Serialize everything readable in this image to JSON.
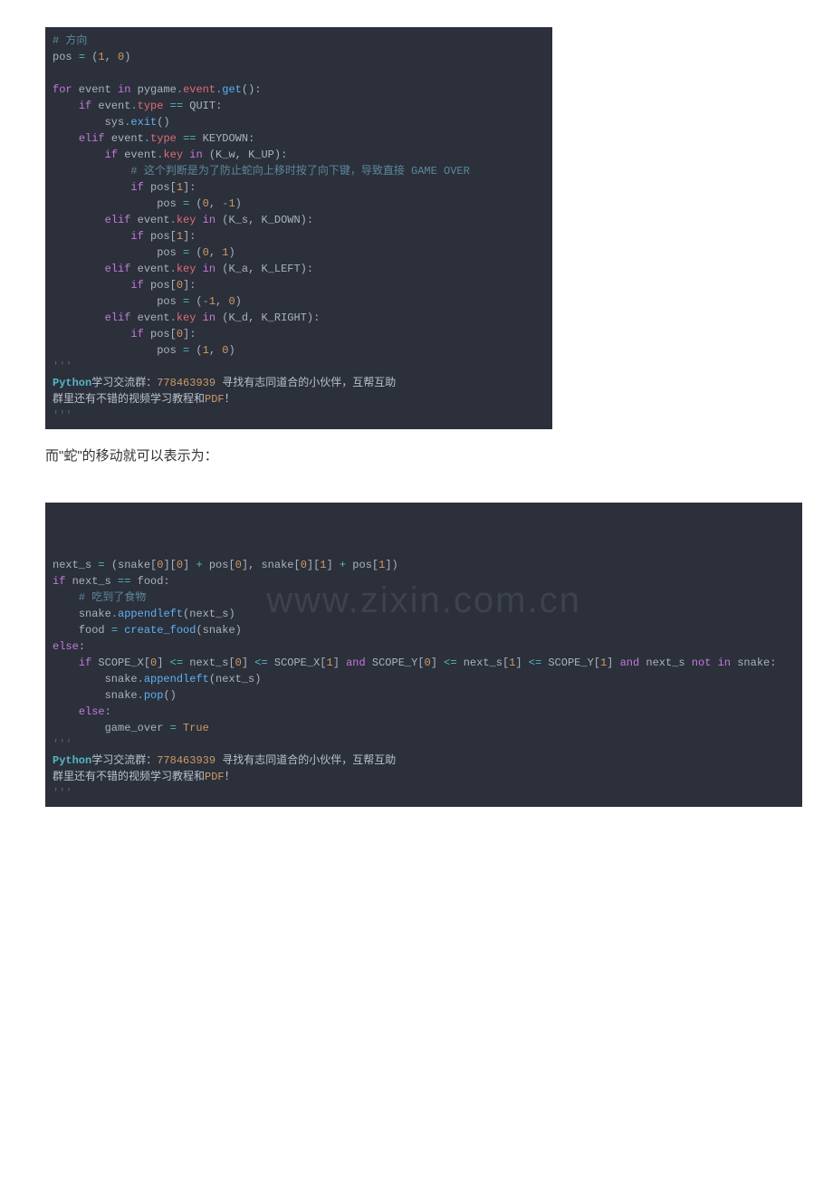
{
  "block1": {
    "lines": [
      {
        "html": "<span class='c-cmt'># 方向</span>"
      },
      {
        "html": "<span class='c-pl'>pos </span><span class='c-op'>=</span><span class='c-pl'> (</span><span class='c-num'>1</span><span class='c-pl'>, </span><span class='c-num'>0</span><span class='c-pl'>)</span>"
      },
      {
        "html": ""
      },
      {
        "html": "<span class='c-key'>for</span><span class='c-pl'> event </span><span class='c-key'>in</span><span class='c-pl'> pygame</span><span class='c-op'>.</span><span class='c-id'>event</span><span class='c-op'>.</span><span class='c-call2'>get</span><span class='c-pl'>():</span>"
      },
      {
        "html": "    <span class='c-key'>if</span><span class='c-pl'> event</span><span class='c-op'>.</span><span class='c-id'>type</span><span class='c-pl'> </span><span class='c-op'>==</span><span class='c-pl'> QUIT:</span>"
      },
      {
        "html": "        <span class='c-pl'>sys</span><span class='c-op'>.</span><span class='c-call2'>exit</span><span class='c-pl'>()</span>"
      },
      {
        "html": "    <span class='c-key'>elif</span><span class='c-pl'> event</span><span class='c-op'>.</span><span class='c-id'>type</span><span class='c-pl'> </span><span class='c-op'>==</span><span class='c-pl'> KEYDOWN:</span>"
      },
      {
        "html": "        <span class='c-key'>if</span><span class='c-pl'> event</span><span class='c-op'>.</span><span class='c-id'>key</span><span class='c-pl'> </span><span class='c-key'>in</span><span class='c-pl'> (K_w, K_UP):</span>"
      },
      {
        "html": "            <span class='c-cmt'># 这个判断是为了防止蛇向上移时按了向下键，导致直接 GAME OVER</span>"
      },
      {
        "html": "            <span class='c-key'>if</span><span class='c-pl'> pos[</span><span class='c-num'>1</span><span class='c-pl'>]:</span>"
      },
      {
        "html": "                <span class='c-pl'>pos </span><span class='c-op'>=</span><span class='c-pl'> (</span><span class='c-num'>0</span><span class='c-pl'>, </span><span class='c-op'>-</span><span class='c-num'>1</span><span class='c-pl'>)</span>"
      },
      {
        "html": "        <span class='c-key'>elif</span><span class='c-pl'> event</span><span class='c-op'>.</span><span class='c-id'>key</span><span class='c-pl'> </span><span class='c-key'>in</span><span class='c-pl'> (K_s, K_DOWN):</span>"
      },
      {
        "html": "            <span class='c-key'>if</span><span class='c-pl'> pos[</span><span class='c-num'>1</span><span class='c-pl'>]:</span>"
      },
      {
        "html": "                <span class='c-pl'>pos </span><span class='c-op'>=</span><span class='c-pl'> (</span><span class='c-num'>0</span><span class='c-pl'>, </span><span class='c-num'>1</span><span class='c-pl'>)</span>"
      },
      {
        "html": "        <span class='c-key'>elif</span><span class='c-pl'> event</span><span class='c-op'>.</span><span class='c-id'>key</span><span class='c-pl'> </span><span class='c-key'>in</span><span class='c-pl'> (K_a, K_LEFT):</span>"
      },
      {
        "html": "            <span class='c-key'>if</span><span class='c-pl'> pos[</span><span class='c-num'>0</span><span class='c-pl'>]:</span>"
      },
      {
        "html": "                <span class='c-pl'>pos </span><span class='c-op'>=</span><span class='c-pl'> (</span><span class='c-op'>-</span><span class='c-num'>1</span><span class='c-pl'>, </span><span class='c-num'>0</span><span class='c-pl'>)</span>"
      },
      {
        "html": "        <span class='c-key'>elif</span><span class='c-pl'> event</span><span class='c-op'>.</span><span class='c-id'>key</span><span class='c-pl'> </span><span class='c-key'>in</span><span class='c-pl'> (K_d, K_RIGHT):</span>"
      },
      {
        "html": "            <span class='c-key'>if</span><span class='c-pl'> pos[</span><span class='c-num'>0</span><span class='c-pl'>]:</span>"
      },
      {
        "html": "                <span class='c-pl'>pos </span><span class='c-op'>=</span><span class='c-pl'> (</span><span class='c-num'>1</span><span class='c-pl'>, </span><span class='c-num'>0</span><span class='c-pl'>)</span>"
      },
      {
        "html": "<span class='c-dq'>'''</span>"
      },
      {
        "html": "<span class='footer-line'><span class='py'>Python</span>学习交流群：<span class='num'>778463939</span> 寻找有志同道合的小伙伴，互帮互助</span>"
      },
      {
        "html": "<span class='footer-line'>群里还有不错的视频学习教程和<span class='pdf'>PDF</span>！</span>"
      },
      {
        "html": "<span class='c-dq'>'''</span>"
      }
    ]
  },
  "paragraph1": "而\"蛇\"的移动就可以表示为：",
  "block2": {
    "watermark": "www.zixin.com.cn",
    "lines": [
      {
        "html": "<span class='c-pl'>next_s </span><span class='c-op'>=</span><span class='c-pl'> (snake[</span><span class='c-num'>0</span><span class='c-pl'>][</span><span class='c-num'>0</span><span class='c-pl'>] </span><span class='c-op'>+</span><span class='c-pl'> pos[</span><span class='c-num'>0</span><span class='c-pl'>], snake[</span><span class='c-num'>0</span><span class='c-pl'>][</span><span class='c-num'>1</span><span class='c-pl'>] </span><span class='c-op'>+</span><span class='c-pl'> pos[</span><span class='c-num'>1</span><span class='c-pl'>])</span>"
      },
      {
        "html": "<span class='c-key'>if</span><span class='c-pl'> next_s </span><span class='c-op'>==</span><span class='c-pl'> food:</span>"
      },
      {
        "html": "    <span class='c-cmt'># 吃到了食物</span>"
      },
      {
        "html": "    <span class='c-pl'>snake</span><span class='c-op'>.</span><span class='c-call2'>appendleft</span><span class='c-pl'>(next_s)</span>"
      },
      {
        "html": "    <span class='c-pl'>food </span><span class='c-op'>=</span><span class='c-pl'> </span><span class='c-call2'>create_food</span><span class='c-pl'>(snake)</span>"
      },
      {
        "html": "<span class='c-key'>else</span><span class='c-pl'>:</span>"
      },
      {
        "html": "    <span class='c-key'>if</span><span class='c-pl'> SCOPE_X[</span><span class='c-num'>0</span><span class='c-pl'>] </span><span class='c-op'>&lt;=</span><span class='c-pl'> next_s[</span><span class='c-num'>0</span><span class='c-pl'>] </span><span class='c-op'>&lt;=</span><span class='c-pl'> SCOPE_X[</span><span class='c-num'>1</span><span class='c-pl'>] </span><span class='c-key'>and</span><span class='c-pl'> SCOPE_Y[</span><span class='c-num'>0</span><span class='c-pl'>] </span><span class='c-op'>&lt;=</span><span class='c-pl'> next_s[</span><span class='c-num'>1</span><span class='c-pl'>] </span><span class='c-op'>&lt;=</span><span class='c-pl'> SCOPE_Y[</span><span class='c-num'>1</span><span class='c-pl'>] </span><span class='c-key'>and</span><span class='c-pl'> next_s </span><span class='c-key'>not in</span><span class='c-pl'> snake:</span>"
      },
      {
        "html": "        <span class='c-pl'>snake</span><span class='c-op'>.</span><span class='c-call2'>appendleft</span><span class='c-pl'>(next_s)</span>"
      },
      {
        "html": "        <span class='c-pl'>snake</span><span class='c-op'>.</span><span class='c-call2'>pop</span><span class='c-pl'>()</span>"
      },
      {
        "html": "    <span class='c-key'>else</span><span class='c-pl'>:</span>"
      },
      {
        "html": "        <span class='c-pl'>game_over </span><span class='c-op'>=</span><span class='c-pl'> </span><span class='c-const'>True</span>"
      },
      {
        "html": "<span class='c-dq'>'''</span>"
      },
      {
        "html": "<span class='footer-line'><span class='py'>Python</span>学习交流群：<span class='num'>778463939</span> 寻找有志同道合的小伙伴，互帮互助</span>"
      },
      {
        "html": "<span class='footer-line'>群里还有不错的视频学习教程和<span class='pdf'>PDF</span>！</span>"
      },
      {
        "html": "<span class='c-dq'>'''</span>"
      }
    ]
  }
}
